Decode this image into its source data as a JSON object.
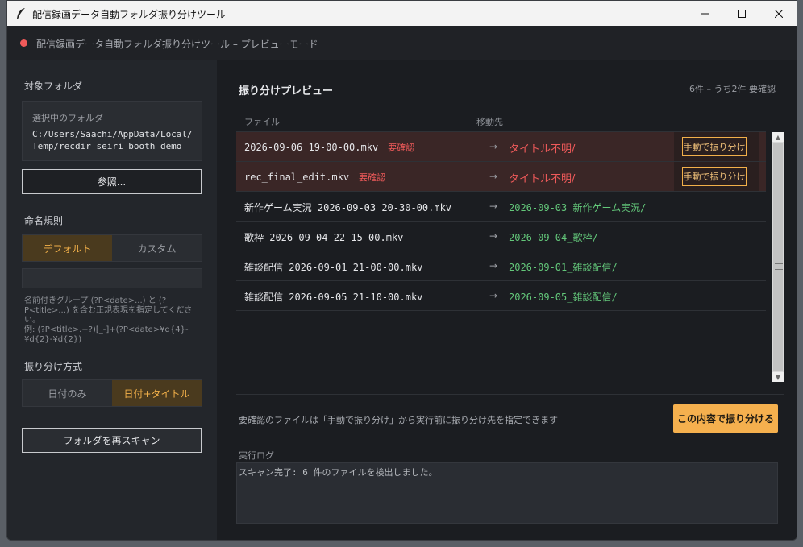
{
  "window": {
    "title": "配信録画データ自動フォルダ振り分けツール",
    "controls": {
      "minimize": "—",
      "maximize": "☐",
      "close": "✕"
    }
  },
  "status": {
    "text": "配信録画データ自動フォルダ振り分けツール – プレビューモード",
    "dot_color": "#f05a5a"
  },
  "sidebar": {
    "target_title": "対象フォルダ",
    "selected_caption": "選択中のフォルダ",
    "selected_path": "C:/Users/Saachi/AppData/Local/\nTemp/recdir_seiri_booth_demo",
    "browse_label": "参照...",
    "naming_title": "命名規則",
    "naming_options": [
      "デフォルト",
      "カスタム"
    ],
    "naming_selected": "デフォルト",
    "rule_value": "",
    "help_text": "名前付きグループ (?P<date>...) と (?P<title>...) を含む正規表現を指定してください。\n例: (?P<title>.+?)[_-]+(?P<date>¥d{4}-¥d{2}-¥d{2})",
    "sort_title": "振り分け方式",
    "sort_options": [
      "日付のみ",
      "日付+タイトル"
    ],
    "sort_selected": "日付+タイトル",
    "rescan_label": "フォルダを再スキャン"
  },
  "main": {
    "heading": "振り分けプレビュー",
    "count": "6件 – うち2件 要確認",
    "columns": {
      "file": "ファイル",
      "dest": "移動先"
    },
    "rows": [
      {
        "file": "2026-09-06 19-00-00.mkv",
        "badge": "要確認",
        "arrow": "→",
        "dest": "タイトル不明/",
        "needs_review": true,
        "manual_label": "手動で振り分け"
      },
      {
        "file": "rec_final_edit.mkv",
        "badge": "要確認",
        "arrow": "→",
        "dest": "タイトル不明/",
        "needs_review": true,
        "manual_label": "手動で振り分け"
      },
      {
        "file": "新作ゲーム実況 2026-09-03 20-30-00.mkv",
        "badge": "",
        "arrow": "→",
        "dest": "2026-09-03_新作ゲーム実況/",
        "needs_review": false,
        "manual_label": ""
      },
      {
        "file": "歌枠 2026-09-04 22-15-00.mkv",
        "badge": "",
        "arrow": "→",
        "dest": "2026-09-04_歌枠/",
        "needs_review": false,
        "manual_label": ""
      },
      {
        "file": "雑談配信 2026-09-01 21-00-00.mkv",
        "badge": "",
        "arrow": "→",
        "dest": "2026-09-01_雑談配信/",
        "needs_review": false,
        "manual_label": ""
      },
      {
        "file": "雑談配信 2026-09-05 21-10-00.mkv",
        "badge": "",
        "arrow": "→",
        "dest": "2026-09-05_雑談配信/",
        "needs_review": false,
        "manual_label": ""
      }
    ],
    "hint": "要確認のファイルは「手動で振り分け」から実行前に振り分け先を指定できます",
    "apply_label": "この内容で振り分ける",
    "log_label": "実行ログ",
    "log_text": "スキャン完了: 6 件のファイルを検出しました。"
  },
  "colors": {
    "accent": "#f5b04e",
    "warning": "#f05a5a",
    "ok": "#63c77a",
    "background": "#1b1d21",
    "sidebar": "#23262b"
  }
}
